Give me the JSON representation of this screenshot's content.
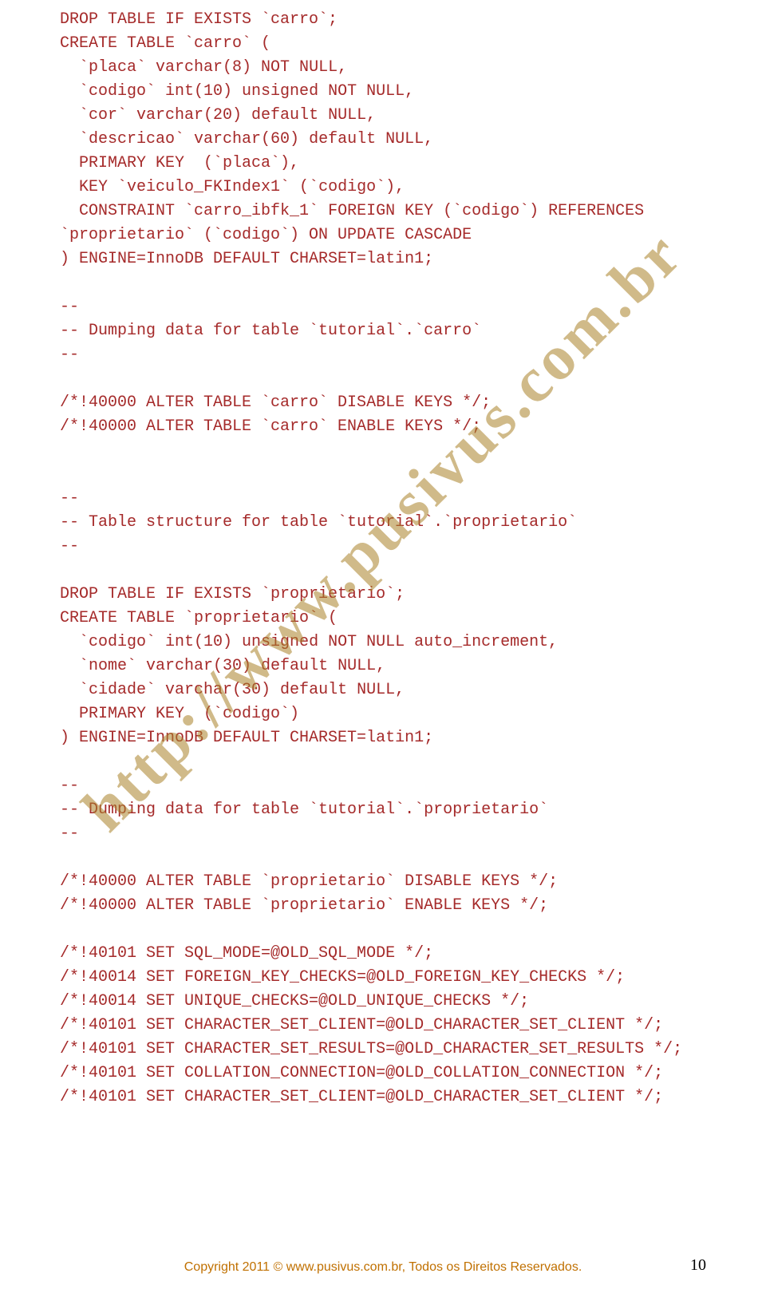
{
  "watermark": "http://www.pusivus.com.br",
  "code_lines": [
    "DROP TABLE IF EXISTS `carro`;",
    "CREATE TABLE `carro` (",
    "  `placa` varchar(8) NOT NULL,",
    "  `codigo` int(10) unsigned NOT NULL,",
    "  `cor` varchar(20) default NULL,",
    "  `descricao` varchar(60) default NULL,",
    "  PRIMARY KEY  (`placa`),",
    "  KEY `veiculo_FKIndex1` (`codigo`),",
    "  CONSTRAINT `carro_ibfk_1` FOREIGN KEY (`codigo`) REFERENCES `proprietario` (`codigo`) ON UPDATE CASCADE",
    ") ENGINE=InnoDB DEFAULT CHARSET=latin1;",
    "",
    "--",
    "-- Dumping data for table `tutorial`.`carro`",
    "--",
    "",
    "/*!40000 ALTER TABLE `carro` DISABLE KEYS */;",
    "/*!40000 ALTER TABLE `carro` ENABLE KEYS */;",
    "",
    "",
    "--",
    "-- Table structure for table `tutorial`.`proprietario`",
    "--",
    "",
    "DROP TABLE IF EXISTS `proprietario`;",
    "CREATE TABLE `proprietario` (",
    "  `codigo` int(10) unsigned NOT NULL auto_increment,",
    "  `nome` varchar(30) default NULL,",
    "  `cidade` varchar(30) default NULL,",
    "  PRIMARY KEY  (`codigo`)",
    ") ENGINE=InnoDB DEFAULT CHARSET=latin1;",
    "",
    "--",
    "-- Dumping data for table `tutorial`.`proprietario`",
    "--",
    "",
    "/*!40000 ALTER TABLE `proprietario` DISABLE KEYS */;",
    "/*!40000 ALTER TABLE `proprietario` ENABLE KEYS */;",
    "",
    "/*!40101 SET SQL_MODE=@OLD_SQL_MODE */;",
    "/*!40014 SET FOREIGN_KEY_CHECKS=@OLD_FOREIGN_KEY_CHECKS */;",
    "/*!40014 SET UNIQUE_CHECKS=@OLD_UNIQUE_CHECKS */;",
    "/*!40101 SET CHARACTER_SET_CLIENT=@OLD_CHARACTER_SET_CLIENT */;",
    "/*!40101 SET CHARACTER_SET_RESULTS=@OLD_CHARACTER_SET_RESULTS */;",
    "/*!40101 SET COLLATION_CONNECTION=@OLD_COLLATION_CONNECTION */;",
    "/*!40101 SET CHARACTER_SET_CLIENT=@OLD_CHARACTER_SET_CLIENT */;"
  ],
  "footer": {
    "copyright": "Copyright 2011 © www.pusivus.com.br, Todos os Direitos Reservados.",
    "page_number": "10"
  }
}
